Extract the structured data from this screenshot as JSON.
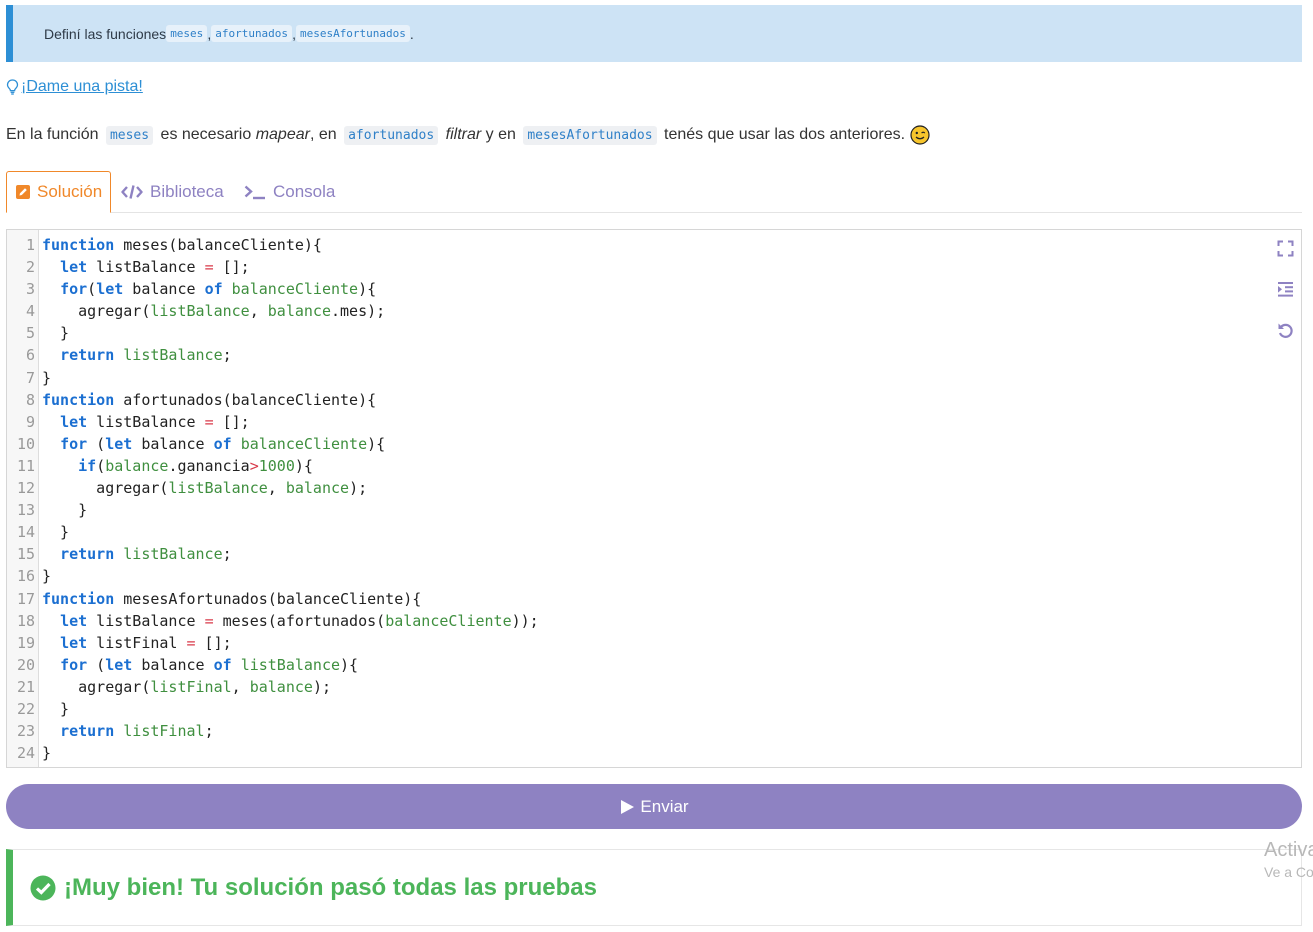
{
  "task": {
    "prefix": "Definí las funciones ",
    "fn1": "meses",
    "sep1": ", ",
    "fn2": "afortunados",
    "sep2": ", ",
    "fn3": "mesesAfortunados",
    "suffix": "."
  },
  "hint": {
    "link_label": "¡Dame una pista!",
    "t1": "En la función ",
    "c1": "meses",
    "t2": " es necesario ",
    "e1": "mapear",
    "t3": ", en ",
    "c2": "afortunados",
    "t4": " ",
    "e2": "filtrar",
    "t5": " y en ",
    "c3": "mesesAfortunados",
    "t6": " tenés que usar las dos anteriores."
  },
  "tabs": {
    "solution": "Solución",
    "library": "Biblioteca",
    "console": "Consola"
  },
  "editor": {
    "line_numbers": [
      "1",
      "2",
      "3",
      "4",
      "5",
      "6",
      "7",
      "8",
      "9",
      "10",
      "11",
      "12",
      "13",
      "14",
      "15",
      "16",
      "17",
      "18",
      "19",
      "20",
      "21",
      "22",
      "23",
      "24"
    ],
    "tools": [
      "fullscreen-icon",
      "indent-icon",
      "reset-icon"
    ]
  },
  "submit": {
    "label": "Enviar"
  },
  "result": {
    "message": "¡Muy bien! Tu solución pasó todas las pruebas"
  },
  "watermark": {
    "line1": "Activar Windows",
    "line2": "Ve a Configuración para activar Windows."
  },
  "colors": {
    "accent_purple": "#8e82c2",
    "success_green": "#4cb55a",
    "info_blue": "#2d8fd5",
    "tab_orange": "#f0882a"
  }
}
